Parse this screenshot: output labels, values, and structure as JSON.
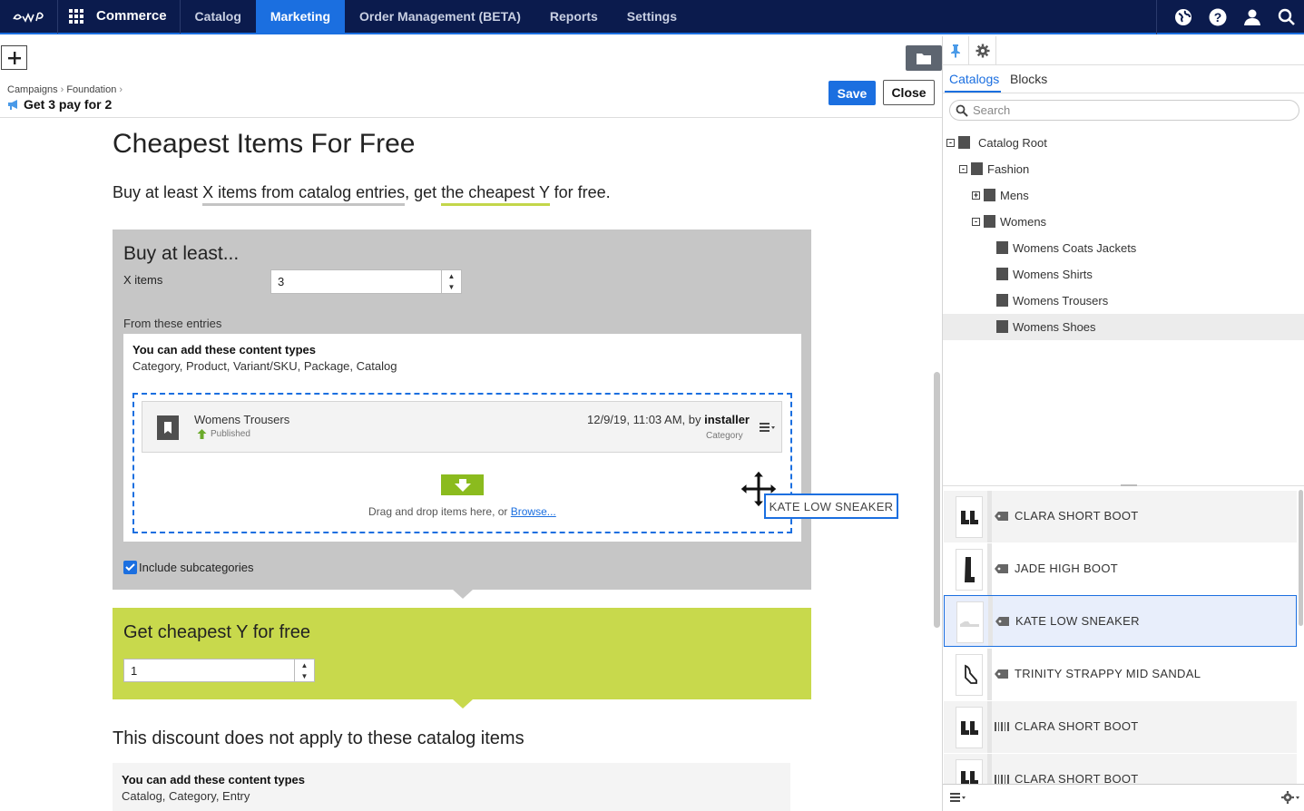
{
  "nav": {
    "app_name": "Commerce",
    "items": [
      "Catalog",
      "Marketing",
      "Order Management (BETA)",
      "Reports",
      "Settings"
    ],
    "active": "Marketing",
    "right_icons": [
      "globe-icon",
      "help-icon",
      "user-icon",
      "search-icon"
    ]
  },
  "breadcrumb": {
    "items": [
      "Campaigns",
      "Foundation"
    ],
    "title": "Get 3 pay for 2"
  },
  "toolbar": {
    "save_label": "Save",
    "close_label": "Close"
  },
  "main": {
    "heading": "Cheapest Items For Free",
    "sentence": {
      "part1": "Buy at least ",
      "link1": "X items from catalog entries",
      "part2": ", get ",
      "link2": "the cheapest Y",
      "part3": " for free."
    },
    "buy_section": {
      "heading": "Buy at least...",
      "x_label": "X items",
      "x_value": "3",
      "from_label": "From these entries",
      "content_types_title": "You can add these content types",
      "content_types": "Category, Product, Variant/SKU, Package, Catalog",
      "entry": {
        "name": "Womens Trousers",
        "status": "Published",
        "date": "12/9/19, 11:03 AM, by ",
        "author": "installer",
        "type": "Category"
      },
      "drop_text": "Drag and drop items here, or ",
      "browse_link": "Browse...",
      "include_subcategories": "Include subcategories",
      "include_checked": true
    },
    "get_section": {
      "heading": "Get cheapest Y for free",
      "y_value": "1"
    },
    "exclude_section": {
      "heading": "This discount does not apply to these catalog items",
      "content_types_title": "You can add these content types",
      "content_types": "Catalog, Category, Entry"
    }
  },
  "drag": {
    "tooltip": "KATE LOW SNEAKER"
  },
  "right_pane": {
    "tabs": [
      "Catalogs",
      "Blocks"
    ],
    "active_tab": "Catalogs",
    "search_placeholder": "Search",
    "tree": [
      {
        "label": "Catalog Root",
        "depth": 0,
        "toggle": "-"
      },
      {
        "label": "Fashion",
        "depth": 1,
        "toggle": "-"
      },
      {
        "label": "Mens",
        "depth": 2,
        "toggle": "+"
      },
      {
        "label": "Womens",
        "depth": 2,
        "toggle": "-"
      },
      {
        "label": "Womens Coats Jackets",
        "depth": 3,
        "toggle": ""
      },
      {
        "label": "Womens Shirts",
        "depth": 3,
        "toggle": ""
      },
      {
        "label": "Womens Trousers",
        "depth": 3,
        "toggle": ""
      },
      {
        "label": "Womens Shoes",
        "depth": 3,
        "toggle": "",
        "selected": true
      }
    ],
    "products": [
      {
        "name": "CLARA SHORT BOOT",
        "type": "product"
      },
      {
        "name": "JADE HIGH BOOT",
        "type": "product"
      },
      {
        "name": "KATE LOW SNEAKER",
        "type": "product",
        "selected": true
      },
      {
        "name": "TRINITY STRAPPY MID SANDAL",
        "type": "product"
      },
      {
        "name": "CLARA SHORT BOOT",
        "type": "variant"
      },
      {
        "name": "CLARA SHORT BOOT",
        "type": "variant"
      }
    ]
  },
  "colors": {
    "nav_bg": "#0b1b4d",
    "accent": "#1b6fe0",
    "green": "#c8d94c",
    "grey_box": "#c6c6c6"
  }
}
